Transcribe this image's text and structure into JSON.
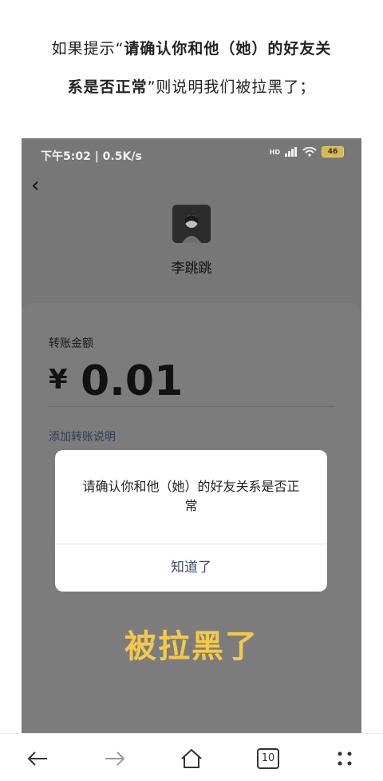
{
  "article": {
    "line1_prefix": "如果提示“",
    "line1_bold": "请确认你和他（她）的好友关",
    "line2_bold": "系是否正常",
    "line2_suffix": "”则说明我们被拉黑了；"
  },
  "phone": {
    "status": {
      "time_speed": "下午5:02 | 0.5K/s",
      "hd": "HD",
      "battery": "46"
    },
    "contact_name": "李跳跳",
    "amount_label": "转账金额",
    "currency_symbol": "¥",
    "amount_value": "0.01",
    "add_note_link": "添加转账说明",
    "dialog": {
      "message": "请确认你和他（她）的好友关系是否正常",
      "ok_button": "知道了"
    },
    "overlay_caption": "被拉黑了"
  },
  "browser_bar": {
    "tabs_count": "10",
    "icons": [
      "back-arrow-icon",
      "forward-arrow-icon",
      "home-icon",
      "tabs-icon",
      "more-icon"
    ]
  }
}
